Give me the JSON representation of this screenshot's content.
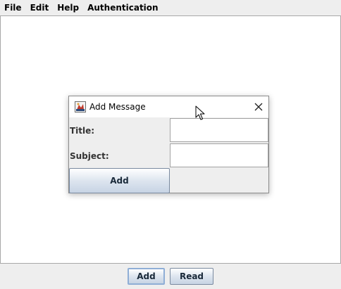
{
  "menubar": {
    "items": [
      {
        "label": "File"
      },
      {
        "label": "Edit"
      },
      {
        "label": "Help"
      },
      {
        "label": "Authentication"
      }
    ]
  },
  "bottombar": {
    "add_label": "Add",
    "read_label": "Read"
  },
  "dialog": {
    "title": "Add Message",
    "icon": "java-app-icon",
    "close_icon": "close-icon",
    "title_label": "Title:",
    "title_value": "",
    "subject_label": "Subject:",
    "subject_value": "",
    "add_label": "Add"
  },
  "colors": {
    "window_bg": "#eeeeee",
    "content_bg": "#ffffff",
    "button_focus_border": "#8faed6"
  }
}
